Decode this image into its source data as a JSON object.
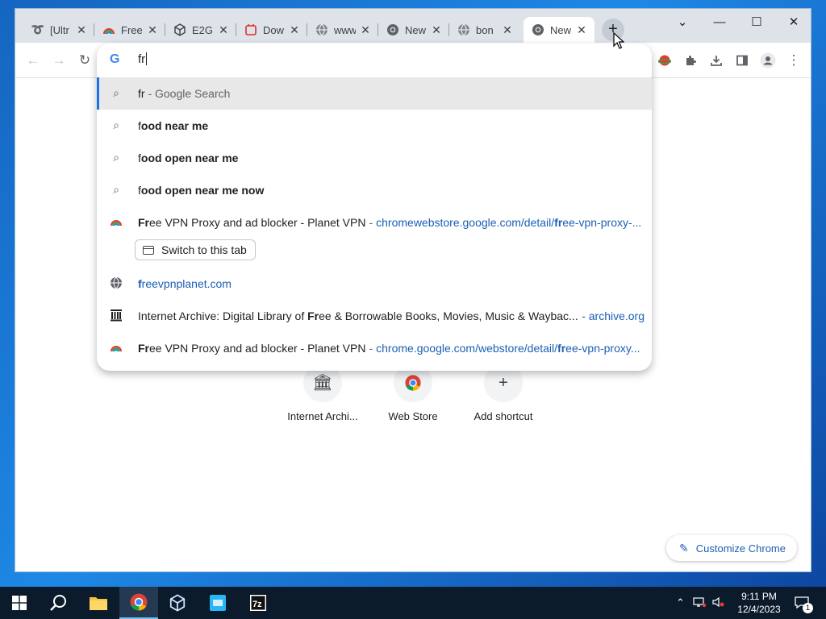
{
  "tabs": [
    {
      "title": "[Ultr",
      "icon": "extension-swirl-icon"
    },
    {
      "title": "Free",
      "icon": "rainbow-icon"
    },
    {
      "title": "E2G",
      "icon": "cube-icon"
    },
    {
      "title": "Dow",
      "icon": "download-icon"
    },
    {
      "title": "www",
      "icon": "globe-icon"
    },
    {
      "title": "New",
      "icon": "chrome-icon"
    },
    {
      "title": "bon",
      "icon": "globe-icon"
    },
    {
      "title": "New",
      "icon": "chrome-icon"
    }
  ],
  "window_controls": {
    "minimize": "—",
    "maximize": "☐",
    "close": "✕",
    "tab_search": "⌄"
  },
  "omnibox": {
    "typed": "fr",
    "suggestions": [
      {
        "query": "fr",
        "suffix": " - Google Search"
      },
      {
        "pre": "f",
        "rest": "ood near me"
      },
      {
        "pre": "f",
        "rest": "ood open near me"
      },
      {
        "pre": "f",
        "rest": "ood open near me now"
      },
      {
        "title_b": "Fr",
        "title_r": "ee VPN Proxy and ad blocker - Planet VPN",
        "url_a": "chromewebstore.google.com/detail/",
        "url_b": "fr",
        "url_c": "ee-vpn-proxy-..."
      },
      {
        "url_b": "f",
        "url_c": "reevpnplanet.com"
      },
      {
        "title_a": "Internet Archive: Digital Library of ",
        "title_b": "Fr",
        "title_c": "ee & Borrowable Books, Movies, Music & Waybac...",
        "right": "- archive.org"
      },
      {
        "title_b": "Fr",
        "title_r": "ee VPN Proxy and ad blocker - Planet VPN",
        "url_a": "chrome.google.com/webstore/detail/",
        "url_b": "fr",
        "url_c": "ee-vpn-proxy..."
      }
    ],
    "switch_tab_label": "Switch to this tab"
  },
  "shortcuts": [
    {
      "label": "Internet Archi...",
      "icon": "archive-icon"
    },
    {
      "label": "Web Store",
      "icon": "web-store-icon"
    },
    {
      "label": "Add shortcut",
      "icon": "plus-icon"
    }
  ],
  "customize_label": "Customize Chrome",
  "taskbar": {
    "clock_time": "9:11 PM",
    "clock_date": "12/4/2023",
    "notification_count": "1"
  },
  "colors": {
    "accent": "#1a73e8",
    "link": "#1a5fb4"
  }
}
